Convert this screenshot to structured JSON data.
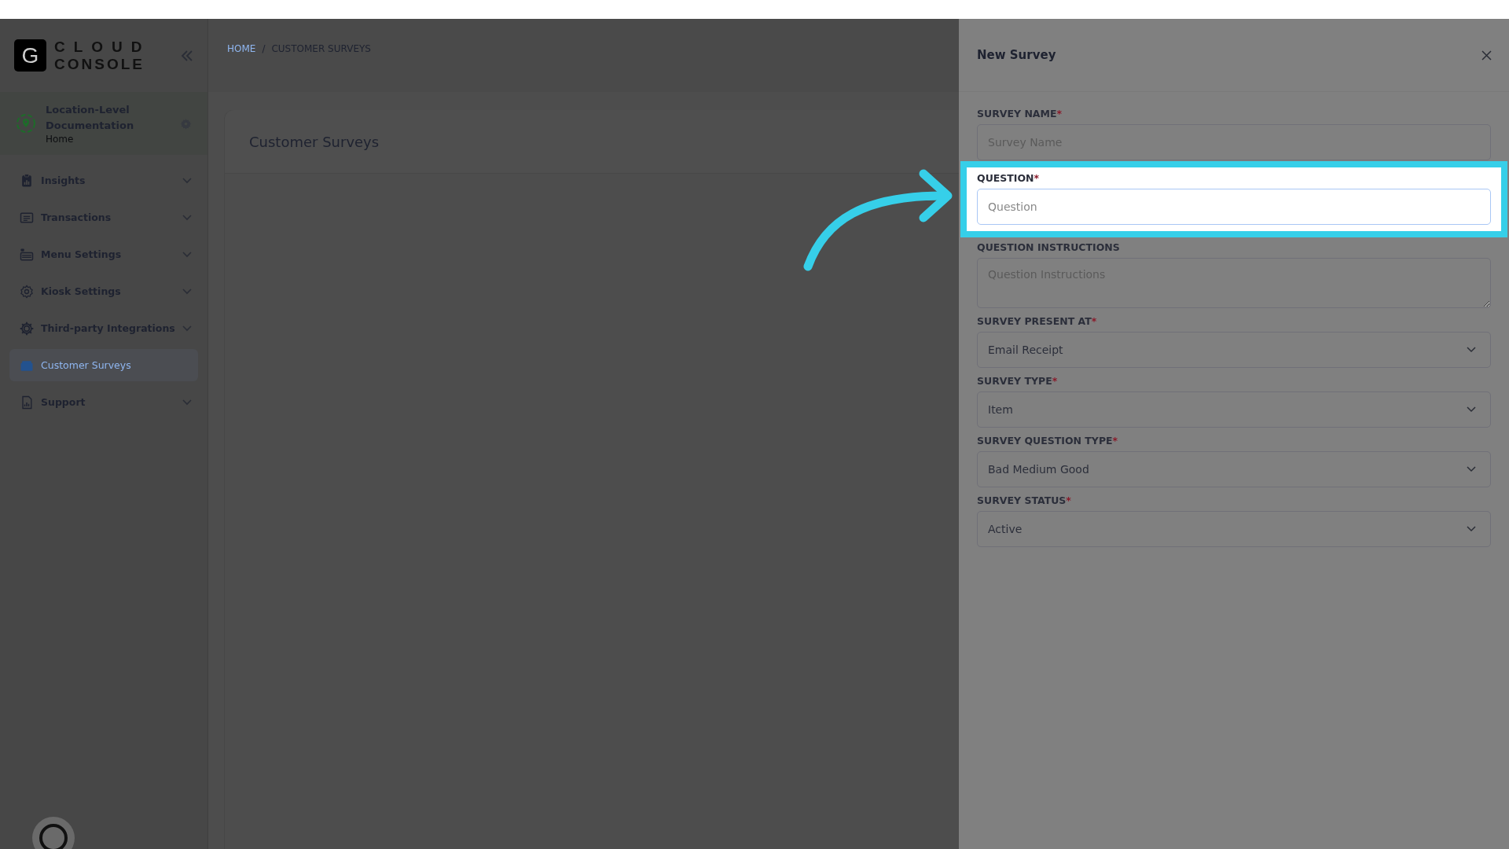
{
  "logo": {
    "mark": "G",
    "line_1": "CLOUD",
    "line_2": "CONSOLE"
  },
  "breadcrumb": {
    "items": [
      {
        "label": "HOME",
        "kind": "link"
      },
      {
        "label": "CUSTOMER SURVEYS",
        "kind": "current"
      }
    ],
    "separator": "/"
  },
  "location": {
    "name": "Location-Level Documentation",
    "subtitle": "Home"
  },
  "nav": [
    {
      "label": "Insights",
      "has_submenu": true,
      "selected": false
    },
    {
      "label": "Transactions",
      "has_submenu": true,
      "selected": false
    },
    {
      "label": "Menu Settings",
      "has_submenu": true,
      "selected": false
    },
    {
      "label": "Kiosk Settings",
      "has_submenu": true,
      "selected": false
    },
    {
      "label": "Third-party Integrations",
      "has_submenu": true,
      "selected": false
    },
    {
      "label": "Customer Surveys",
      "has_submenu": false,
      "selected": true
    },
    {
      "label": "Support",
      "has_submenu": true,
      "selected": false
    }
  ],
  "page": {
    "title": "Customer Surveys"
  },
  "drawer": {
    "title": "New Survey",
    "fields": [
      {
        "label": "SURVEY NAME",
        "required_mark": "*",
        "kind": "text",
        "placeholder": "Survey Name",
        "highlighted": false
      },
      {
        "label": "QUESTION",
        "required_mark": "*",
        "kind": "text",
        "placeholder": "Question",
        "highlighted": true
      },
      {
        "label": "QUESTION INSTRUCTIONS",
        "kind": "textarea",
        "placeholder": "Question Instructions",
        "highlighted": false
      },
      {
        "label": "SURVEY PRESENT AT",
        "required_mark": "*",
        "kind": "select",
        "value": "Email Receipt",
        "highlighted": false
      },
      {
        "label": "SURVEY TYPE",
        "required_mark": "*",
        "kind": "select",
        "value": "Item",
        "highlighted": false
      },
      {
        "label": "SURVEY QUESTION TYPE",
        "required_mark": "*",
        "kind": "select",
        "value": "Bad Medium Good",
        "highlighted": false
      },
      {
        "label": "SURVEY STATUS",
        "required_mark": "*",
        "kind": "select",
        "value": "Active",
        "highlighted": false
      }
    ]
  }
}
